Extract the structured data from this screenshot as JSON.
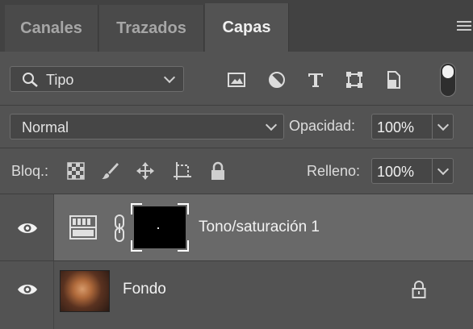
{
  "tabs": [
    {
      "label": "Canales",
      "active": false
    },
    {
      "label": "Trazados",
      "active": false
    },
    {
      "label": "Capas",
      "active": true
    }
  ],
  "filter": {
    "kind_label": "Tipo",
    "icons": [
      "image-filter-icon",
      "adjustment-filter-icon",
      "type-filter-icon",
      "shape-filter-icon",
      "smart-object-filter-icon"
    ]
  },
  "blend": {
    "mode": "Normal",
    "opacity_label": "Opacidad:",
    "opacity_value": "100%"
  },
  "lock": {
    "label": "Bloq.:",
    "fill_label": "Relleno:",
    "fill_value": "100%"
  },
  "layers": [
    {
      "name": "Tono/saturación 1",
      "type": "adjustment",
      "visible": true,
      "selected": true
    },
    {
      "name": "Fondo",
      "type": "background",
      "visible": true,
      "locked": true
    }
  ],
  "colors": {
    "panel": "#535353",
    "tab_bar": "#424242",
    "selected_layer": "#696969"
  }
}
